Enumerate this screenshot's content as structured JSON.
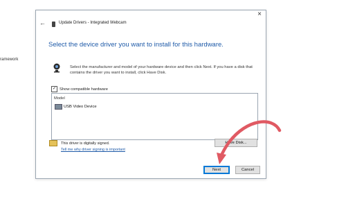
{
  "background": {
    "partial_text": "ramework"
  },
  "dialog": {
    "back_icon": "back-arrow-icon",
    "device_icon": "device-icon",
    "title": "Update Drivers - Integrated Webcam",
    "close_glyph": "×",
    "heading": "Select the device driver you want to install for this hardware.",
    "description": "Select the manufacturer and model of your hardware device and then click Next. If you have a disk that contains the driver you want to install, click Have Disk.",
    "show_compatible": {
      "label": "Show compatible hardware",
      "checked": true,
      "check_glyph": "✓"
    },
    "model_list": {
      "header": "Model",
      "items": [
        "USB Video Device"
      ]
    },
    "signed_text": "This driver is digitally signed.",
    "signing_link": "Tell me why driver signing is important",
    "have_disk_label": "Have Disk...",
    "next_label": "Next",
    "cancel_label": "Cancel"
  },
  "colors": {
    "heading": "#1e5aa8",
    "link": "#1e5aa8",
    "arrow": "#e05a63",
    "default_button_border": "#0078d7"
  }
}
